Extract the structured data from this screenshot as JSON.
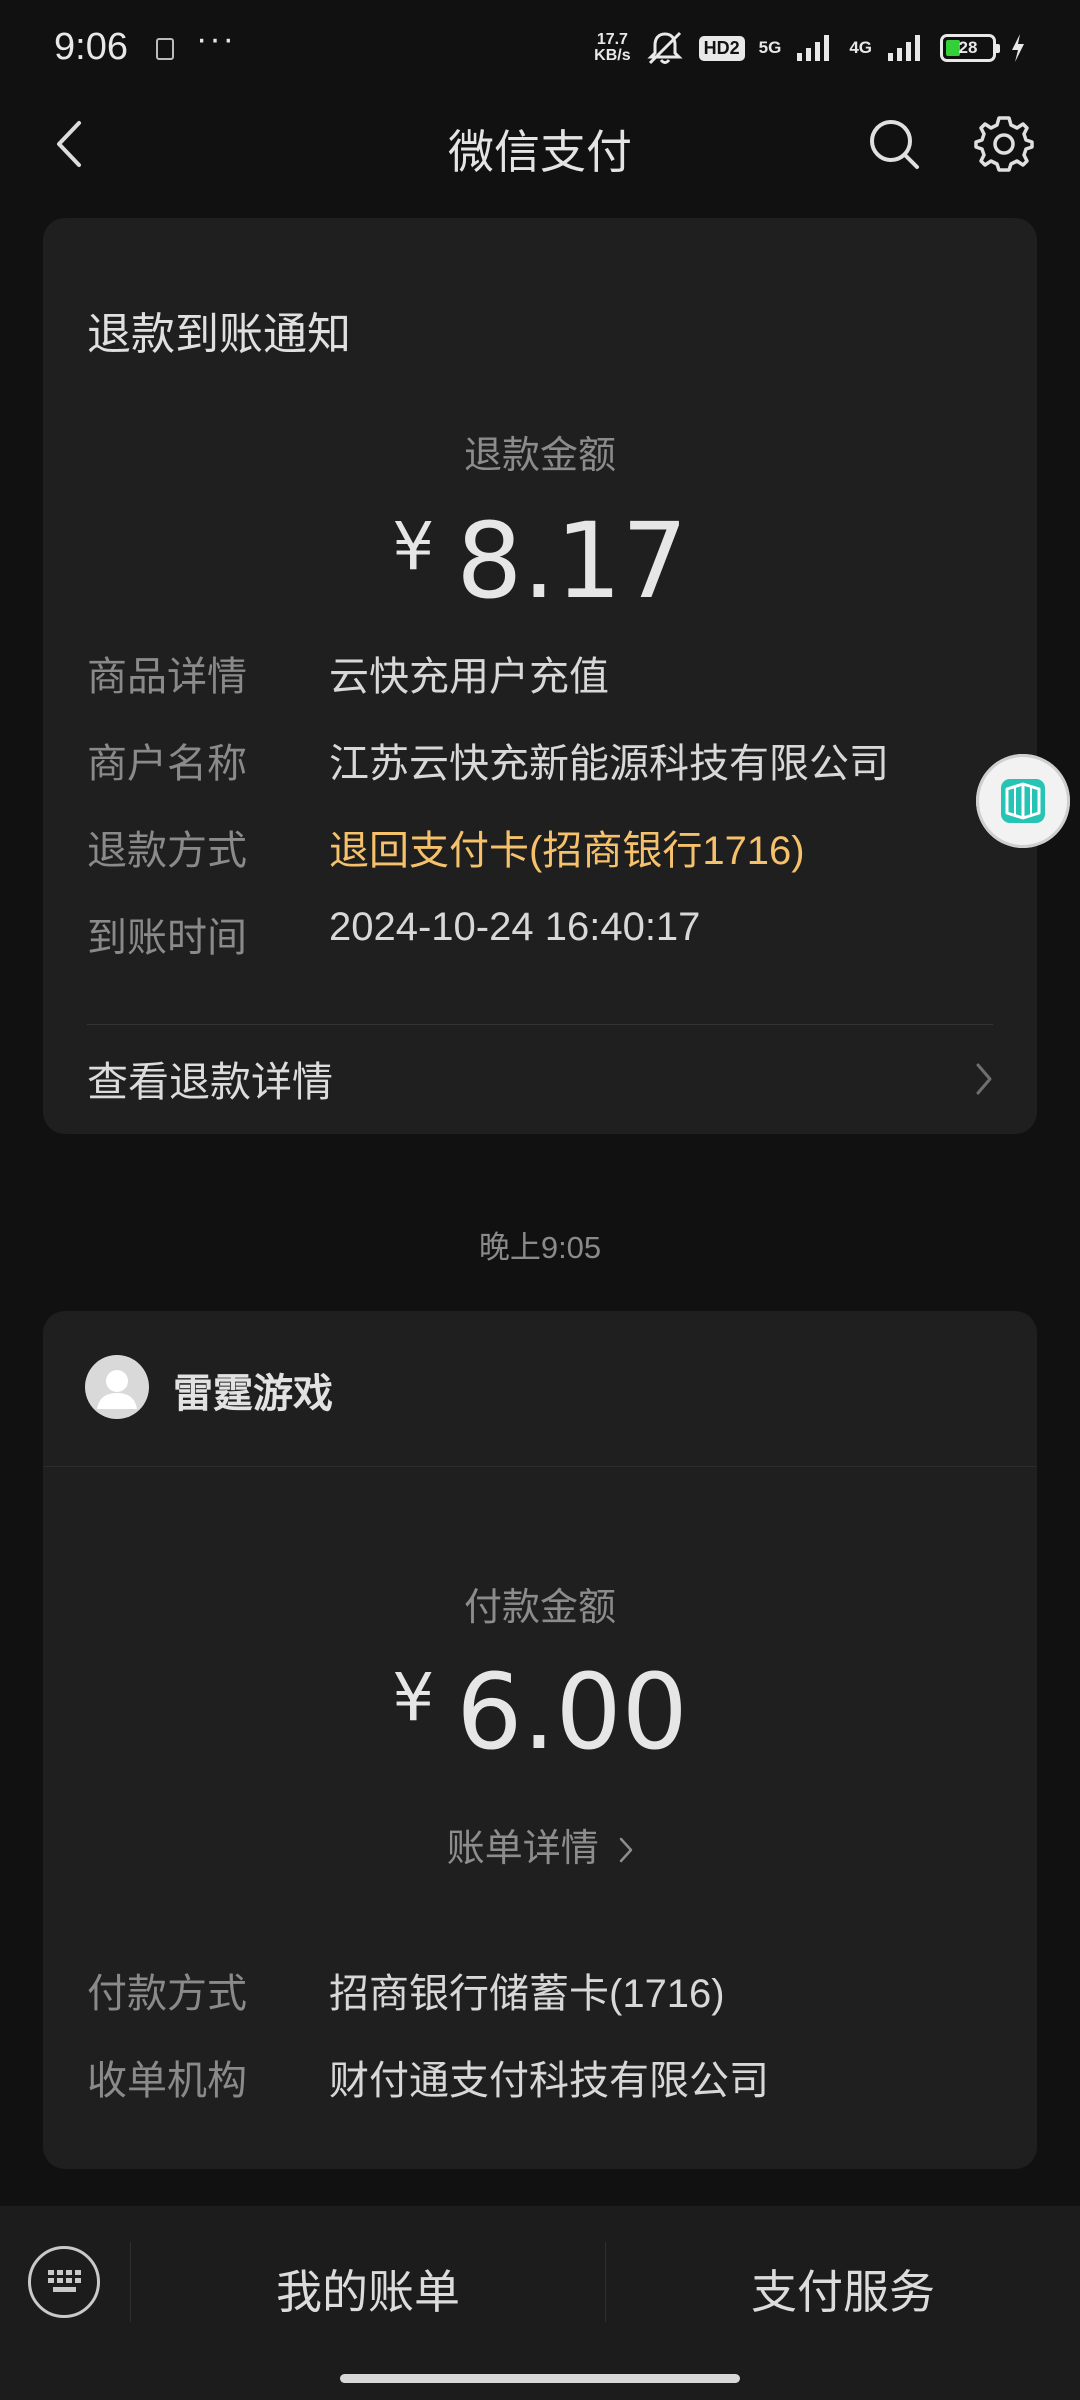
{
  "status_bar": {
    "time": "9:06",
    "dots": "···",
    "speed_top": "17.7",
    "speed_bottom": "KB/s",
    "hd": "HD2",
    "net1": "5G",
    "net2": "4G",
    "battery": "28"
  },
  "nav": {
    "title": "微信支付"
  },
  "refund_card": {
    "title": "退款到账通知",
    "amount_label": "退款金额",
    "currency": "¥",
    "amount": "8.17",
    "rows": [
      {
        "key": "商品详情",
        "value": "云快充用户充值"
      },
      {
        "key": "商户名称",
        "value": "江苏云快充新能源科技有限公司"
      },
      {
        "key": "退款方式",
        "value": "退回支付卡(招商银行1716)"
      },
      {
        "key": "到账时间",
        "value": "2024-10-24 16:40:17"
      }
    ],
    "detail_link": "查看退款详情",
    "accent_color": "#f5c16a"
  },
  "timestamp": "晚上9:05",
  "payment_card": {
    "merchant": "雷霆游戏",
    "amount_label": "付款金额",
    "currency": "¥",
    "amount": "6.00",
    "bill_link": "账单详情",
    "rows": [
      {
        "key": "付款方式",
        "value": "招商银行储蓄卡(1716)"
      },
      {
        "key": "收单机构",
        "value": "财付通支付科技有限公司"
      }
    ]
  },
  "bottom_bar": {
    "my_bills": "我的账单",
    "pay_service": "支付服务"
  },
  "icons": [
    "back-chevron-icon",
    "search-icon",
    "gear-icon",
    "chevron-right-icon",
    "avatar-placeholder-icon",
    "keyboard-icon",
    "floating-assistant-icon"
  ]
}
